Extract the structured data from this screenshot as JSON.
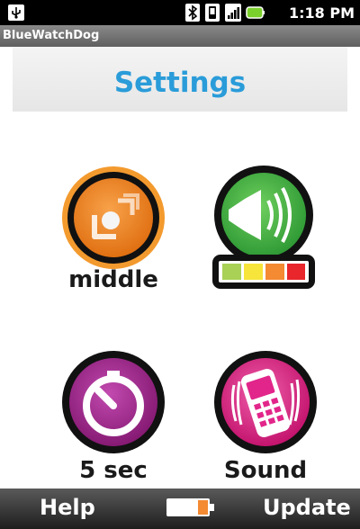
{
  "status_bar": {
    "time": "1:18 PM",
    "icons": [
      "usb-icon",
      "bluetooth-icon",
      "vibrate-icon",
      "signal-icon",
      "battery-icon"
    ]
  },
  "app": {
    "title": "BlueWatchDog"
  },
  "header": {
    "title": "Settings"
  },
  "settings": {
    "distance": {
      "label": "middle",
      "icon": "distance-icon",
      "color": "#f08a24"
    },
    "volume": {
      "icon": "speaker-icon",
      "color": "#4fb44a",
      "level_colors": [
        "#a9d156",
        "#f7e53b",
        "#f48a32",
        "#e8262b"
      ]
    },
    "timer": {
      "label": "5 sec",
      "icon": "stopwatch-icon",
      "color": "#a3208c"
    },
    "alert": {
      "label": "Sound",
      "icon": "phone-icon",
      "color": "#e2258a"
    }
  },
  "bottom_bar": {
    "help_label": "Help",
    "update_label": "Update",
    "battery_icon": "battery-icon"
  }
}
